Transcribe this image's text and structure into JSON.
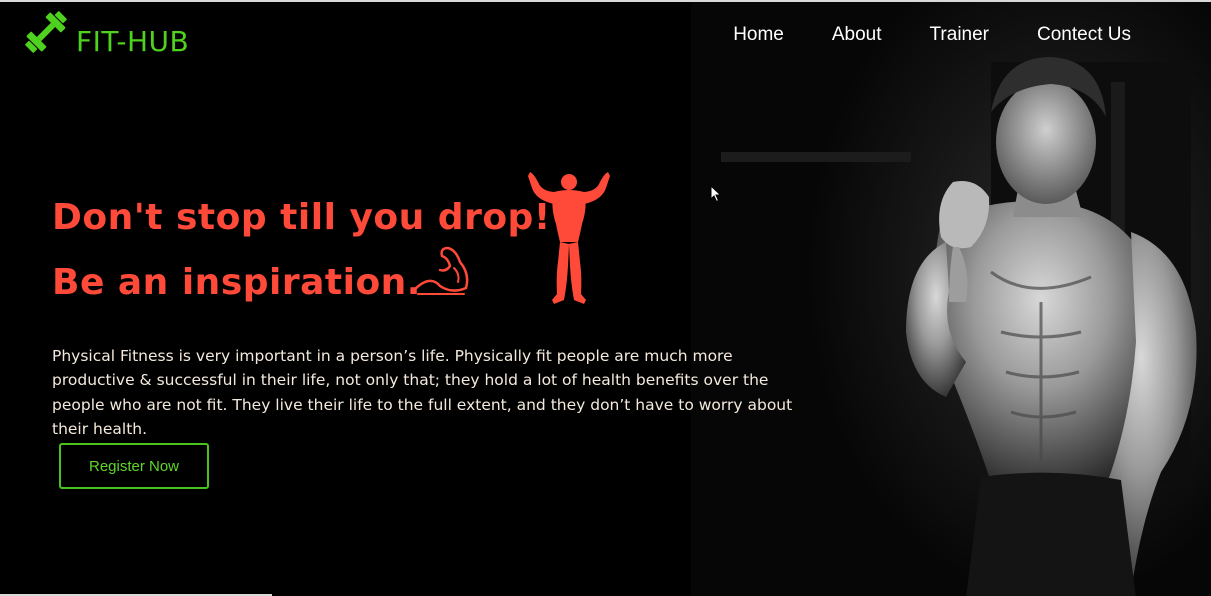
{
  "brand": {
    "logo_icon": "dumbbell-icon",
    "name": "FIT-HUB",
    "color": "#4fd11f"
  },
  "nav": {
    "items": [
      {
        "label": "Home"
      },
      {
        "label": "About"
      },
      {
        "label": "Trainer"
      },
      {
        "label": "Contect Us"
      }
    ]
  },
  "hero": {
    "headline_line1": "Don't stop till you drop!",
    "headline_line2": "Be an inspiration.",
    "accent_color": "#ff4a3a",
    "icons": [
      "bodybuilder-icon",
      "flexed-bicep-icon"
    ],
    "description": "Physical Fitness is very important in a person’s life. Physically fit people are much more productive & successful in their life, not only that; they hold a lot of health benefits over the people who are not fit. They live their life to the full extent, and they don’t have to worry about their health.",
    "cta_label": "Register Now",
    "cta_color": "#48c21c",
    "image": "bodybuilder-photo"
  }
}
